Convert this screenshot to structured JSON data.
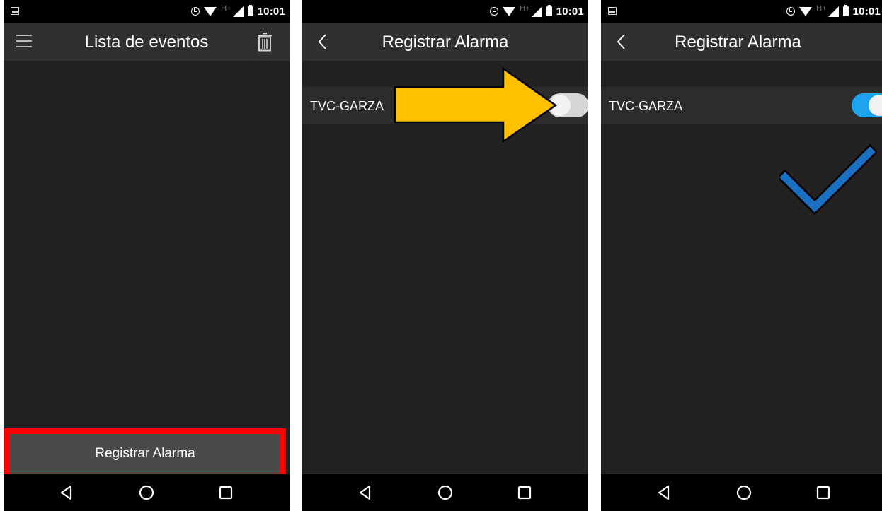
{
  "status_bar": {
    "time": "10:01",
    "network": "H+"
  },
  "screen1": {
    "title": "Lista de eventos",
    "register_button_label": "Registrar Alarma"
  },
  "screen2": {
    "title": "Registrar Alarma",
    "device_name": "TVC-GARZA",
    "switch_on": false
  },
  "screen3": {
    "title": "Registrar Alarma",
    "device_name": "TVC-GARZA",
    "switch_on": true
  },
  "icons": {
    "menu": "hamburger-menu-icon",
    "delete": "trash-icon",
    "back": "back-chevron-icon",
    "nav_back": "triangle-back-icon",
    "nav_home": "circle-home-icon",
    "nav_recents": "square-recents-icon",
    "annotation_arrow": "arrow-right-icon",
    "annotation_check": "checkmark-icon"
  },
  "colors": {
    "highlight_border": "#ff0000",
    "arrow": "#ffc000",
    "checkmark": "#1b6fc2",
    "switch_on": "#1ea3ef",
    "switch_off": "#d6d6d6"
  }
}
